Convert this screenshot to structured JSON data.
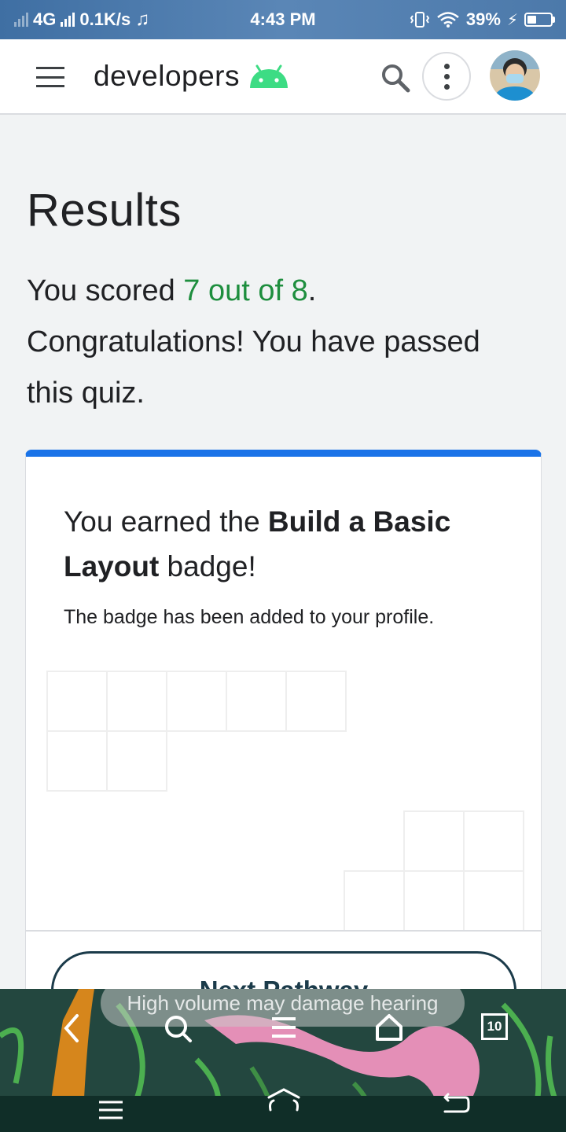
{
  "status_bar": {
    "network": "4G",
    "speed": "0.1K/s",
    "time": "4:43 PM",
    "battery": "39%",
    "icons": [
      "signal-icon",
      "music-note-icon",
      "vibrate-icon",
      "wifi-icon",
      "charging-icon",
      "battery-icon"
    ]
  },
  "app_bar": {
    "logo_text": "developers",
    "icons": [
      "menu-icon",
      "android-icon",
      "search-icon",
      "more-vert-icon",
      "avatar"
    ]
  },
  "main": {
    "title": "Results",
    "score_prefix": "You scored ",
    "score_value": "7 out of 8",
    "score_suffix": ". Congratulations! You have passed this quiz."
  },
  "badge_card": {
    "heading_prefix": "You earned the ",
    "badge_name": "Build a Basic Layout",
    "heading_suffix": " badge!",
    "subtext": "The badge has been added to your profile.",
    "next_button": "Next Pathway"
  },
  "overlay": {
    "toast": "High volume may damage hearing",
    "floating_nav": [
      "back-icon",
      "search-icon",
      "menu-icon",
      "home-icon"
    ],
    "tabs_count": "10",
    "system_nav": [
      "recents-icon",
      "home-icon",
      "back-icon"
    ]
  },
  "colors": {
    "accent": "#1a73e8",
    "success": "#1e8e3e",
    "android_green": "#3ddc84",
    "button_border": "#1b3b4a"
  }
}
